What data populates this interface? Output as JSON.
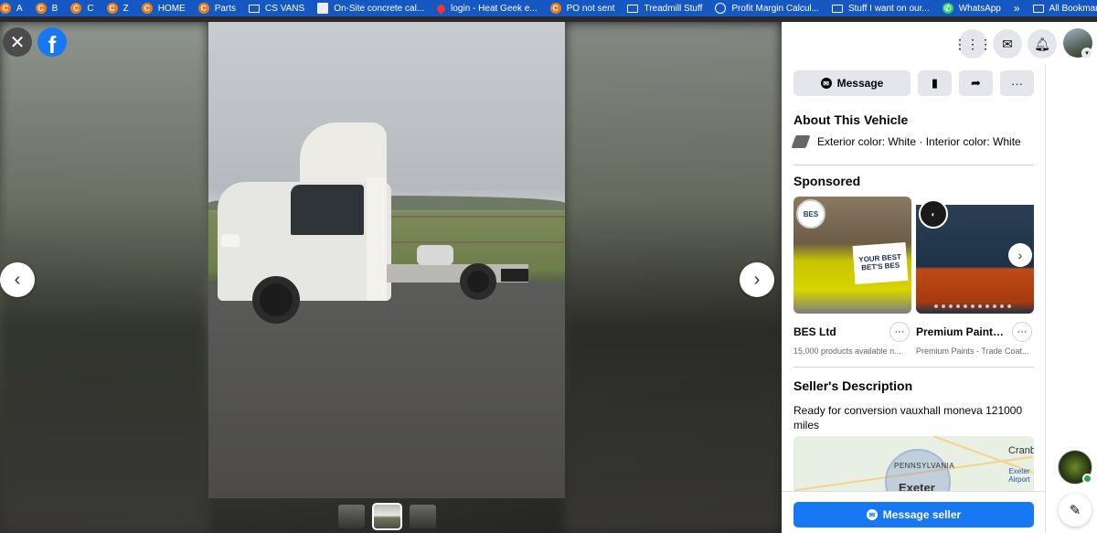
{
  "bookmarks": [
    {
      "label": "A",
      "icon": "c-icon"
    },
    {
      "label": "B",
      "icon": "c-icon"
    },
    {
      "label": "C",
      "icon": "c-icon"
    },
    {
      "label": "Z",
      "icon": "c-icon"
    },
    {
      "label": "HOME",
      "icon": "c-icon"
    },
    {
      "label": "Parts",
      "icon": "c-icon"
    },
    {
      "label": "CS VANS",
      "icon": "folder-icon"
    },
    {
      "label": "On-Site concrete cal...",
      "icon": "image-icon"
    },
    {
      "label": "login - Heat Geek e...",
      "icon": "drop-icon"
    },
    {
      "label": "PO not sent",
      "icon": "c-icon"
    },
    {
      "label": "Treadmill Stuff",
      "icon": "folder-icon"
    },
    {
      "label": "Profit Margin Calcul...",
      "icon": "globe-icon"
    },
    {
      "label": "Stuff I want on our...",
      "icon": "folder-icon"
    },
    {
      "label": "WhatsApp",
      "icon": "whatsapp-icon"
    }
  ],
  "bookmarks_more": "»",
  "bookmarks_all": "All Bookmarks",
  "viewer": {
    "close_glyph": "✕",
    "logo_glyph": "f",
    "prev_glyph": "‹",
    "next_glyph": "›",
    "thumbnail_count": 3,
    "active_thumbnail": 2
  },
  "actions": {
    "message_label": "Message",
    "save_glyph": "▮",
    "share_glyph": "➦",
    "more_glyph": "···"
  },
  "about": {
    "title": "About This Vehicle",
    "colors": "Exterior color: White · Interior color: White"
  },
  "sponsored": {
    "title": "Sponsored",
    "ads": [
      {
        "name": "BES Ltd",
        "subtitle": "15,000 products available n...",
        "badge": "BES",
        "sign": "YOUR BEST BET'S BES"
      },
      {
        "name": "Premium Paints...",
        "subtitle": "Premium Paints - Trade Coat...",
        "badge": "◐"
      }
    ]
  },
  "description": {
    "title": "Seller's Description",
    "text": "Ready for conversion vauxhall  moneva 121000 miles"
  },
  "map": {
    "label_cranbrook": "Cranb",
    "label_airport": "Exeter Airport",
    "label_region": "PENNSYLVANIA",
    "label_city": "Exeter"
  },
  "cta": {
    "label": "Message seller"
  },
  "compose_glyph": "✎"
}
